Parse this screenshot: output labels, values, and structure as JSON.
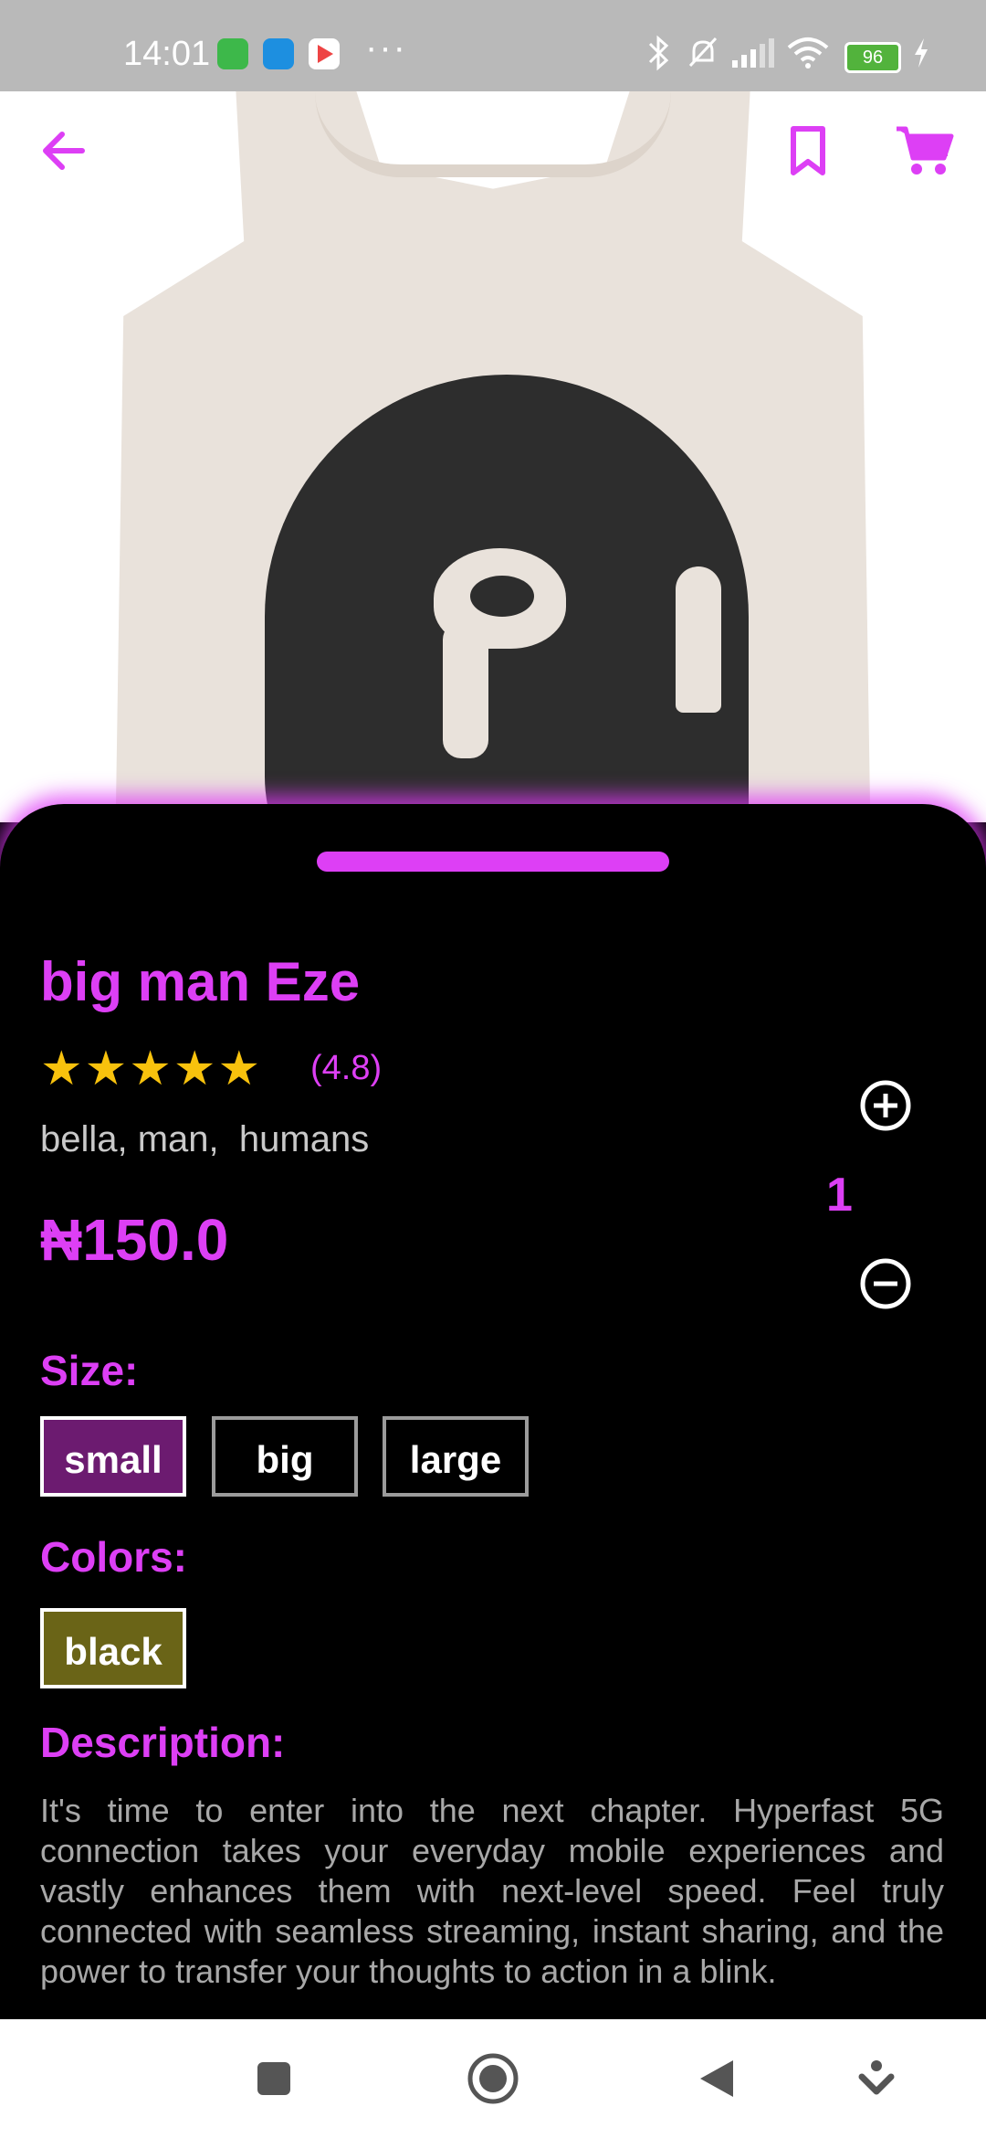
{
  "status_bar": {
    "time": "14:01",
    "battery": "96",
    "icons": [
      "android-app-icon",
      "twitter-icon",
      "play-store-icon",
      "more-dots-icon",
      "bluetooth-icon",
      "mute-icon",
      "signal-icon",
      "wifi-icon",
      "battery-icon",
      "charging-icon"
    ]
  },
  "top_bar": {
    "back_icon": "arrow-left-icon",
    "bookmark_icon": "bookmark-icon",
    "cart_icon": "cart-icon",
    "accent": "#dd3ff5"
  },
  "product": {
    "title": "big man Eze",
    "stars": "★★★★★",
    "rating": "(4.8)",
    "tags": "bella, man,  humans",
    "price": "₦150.0",
    "quantity": "1"
  },
  "size": {
    "label": "Size:",
    "options": [
      "small",
      "big",
      "large"
    ],
    "selected": "small"
  },
  "colors": {
    "label": "Colors:",
    "options": [
      "black"
    ],
    "selected": "black"
  },
  "description": {
    "label": "Description:",
    "text": "It's time to enter into the next chapter. Hyperfast 5G connection takes your everyday mobile experiences and vastly enhances them with next-level speed. Feel truly connected with seamless streaming, instant sharing, and the power to transfer your thoughts to action in a blink."
  },
  "colors_palette": {
    "accent": "#dd3ff5",
    "star": "#f8c20d",
    "selected_size_bg": "#6c1b70",
    "selected_color_bg": "#6a6417"
  }
}
